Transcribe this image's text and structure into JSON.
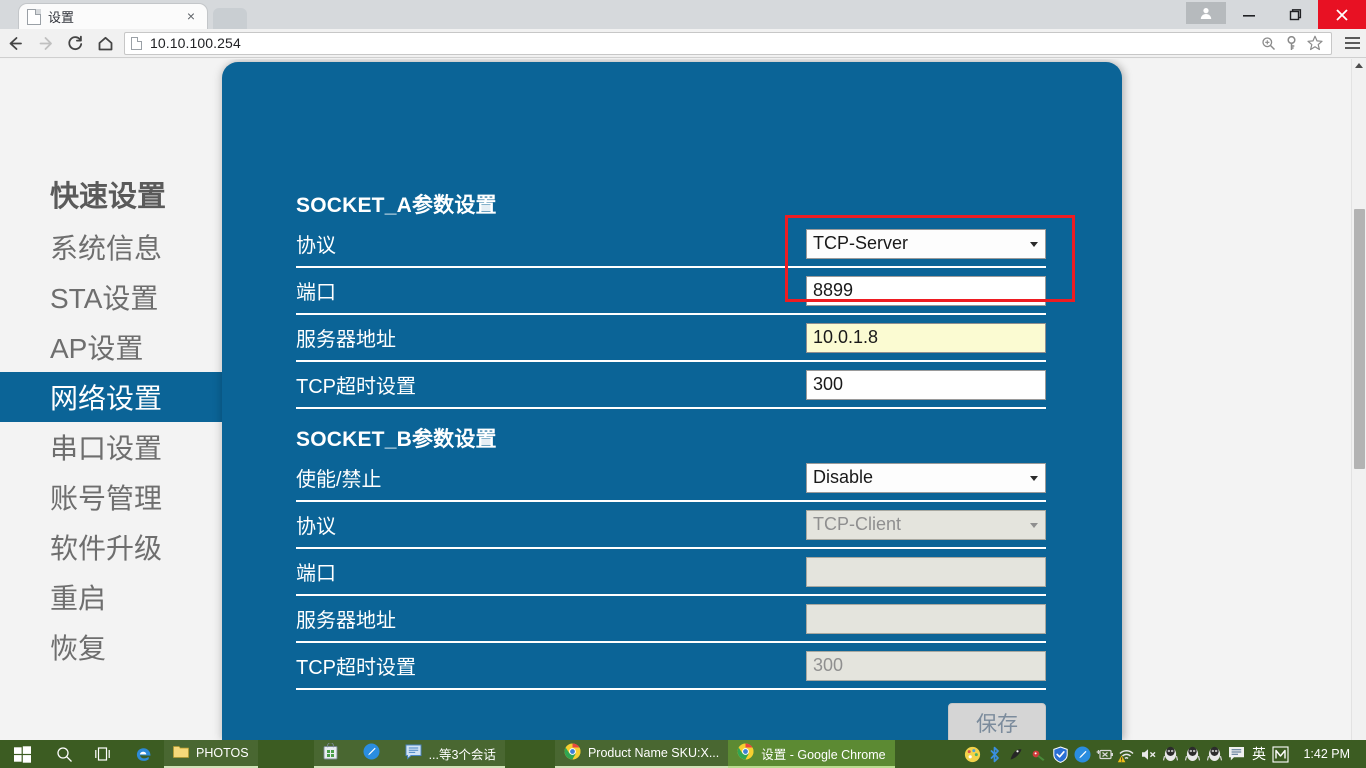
{
  "browser": {
    "tab": {
      "title": "设置",
      "favicon": "page-icon",
      "close": "×"
    },
    "window_controls": {
      "minimize": "—",
      "maximize": "❐",
      "close": "✕"
    },
    "toolbar": {
      "back": "←",
      "forward": "→",
      "reload": "C",
      "home": "⌂",
      "url": "10.10.100.254",
      "omnibox_icons": [
        "zoom-icon",
        "key-icon",
        "star-icon"
      ],
      "menu": "menu-icon"
    }
  },
  "page": {
    "nav": {
      "brand": "快速设置",
      "items": [
        {
          "label": "系统信息",
          "active": false
        },
        {
          "label": "STA设置",
          "active": false
        },
        {
          "label": "AP设置",
          "active": false
        },
        {
          "label": "网络设置",
          "active": true
        },
        {
          "label": "串口设置",
          "active": false
        },
        {
          "label": "账号管理",
          "active": false
        },
        {
          "label": "软件升级",
          "active": false
        },
        {
          "label": "重启",
          "active": false
        },
        {
          "label": "恢复",
          "active": false
        }
      ]
    },
    "socket_a": {
      "title": "SOCKET_A参数设置",
      "rows": [
        {
          "label": "协议",
          "value": "TCP-Server",
          "type": "select",
          "state": "normal"
        },
        {
          "label": "端口",
          "value": "8899",
          "type": "text",
          "state": "normal"
        },
        {
          "label": "服务器地址",
          "value": "10.0.1.8",
          "type": "text",
          "state": "autofill"
        },
        {
          "label": "TCP超时设置",
          "value": "300",
          "type": "text",
          "state": "normal"
        }
      ]
    },
    "socket_b": {
      "title": "SOCKET_B参数设置",
      "rows": [
        {
          "label": "使能/禁止",
          "value": "Disable",
          "type": "select",
          "state": "normal"
        },
        {
          "label": "协议",
          "value": "TCP-Client",
          "type": "select",
          "state": "disabled"
        },
        {
          "label": "端口",
          "value": "",
          "type": "text",
          "state": "empty"
        },
        {
          "label": "服务器地址",
          "value": "",
          "type": "text",
          "state": "empty"
        },
        {
          "label": "TCP超时设置",
          "value": "300",
          "type": "text",
          "state": "disabled"
        }
      ]
    },
    "save_button": "保存",
    "highlight_color": "#ee1c22",
    "accent_color": "#0b6497"
  },
  "taskbar": {
    "start": "windows-logo-icon",
    "search": "search-icon",
    "taskview": "task-view-icon",
    "edge": "edge-icon",
    "pinned": [
      {
        "name": "photos-folder",
        "label": "PHOTOS"
      }
    ],
    "apps": [
      {
        "name": "store-app",
        "label": "",
        "state": "open"
      },
      {
        "name": "notes-app",
        "label": "",
        "state": "open"
      },
      {
        "name": "chat-app",
        "label": "...等3个会话",
        "state": "open"
      },
      {
        "name": "chrome-product",
        "label": "Product Name SKU:X...",
        "state": "open"
      },
      {
        "name": "chrome-settings",
        "label": "设置 - Google Chrome",
        "state": "active"
      }
    ],
    "tray": [
      "palette-icon",
      "bluetooth-icon",
      "mouse-icon",
      "security-icon",
      "shield-icon",
      "drop-icon",
      "battery-icon",
      "wifi-warning-icon",
      "volume-mute-icon",
      "qq-icon",
      "qq-icon",
      "qq-icon",
      "chat-bubble-icon",
      "ime-icon",
      "m-icon"
    ],
    "ime_label": "英",
    "m_label": "M",
    "clock": "1:42 PM"
  }
}
